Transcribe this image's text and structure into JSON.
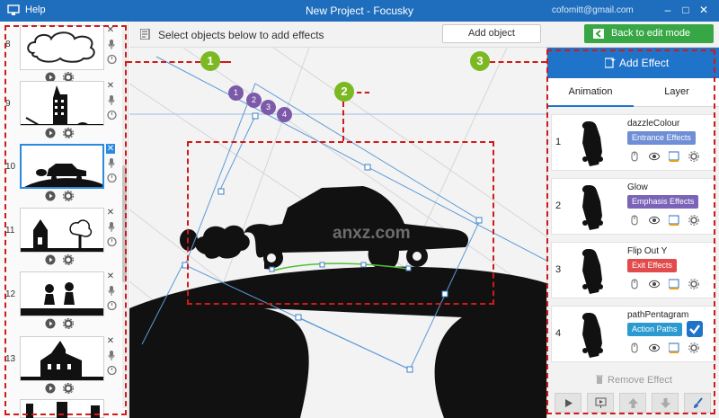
{
  "titlebar": {
    "help": "Help",
    "title": "New Project - Focusky",
    "user": "cofomitt@gmail.com"
  },
  "slides": [
    {
      "num": "8",
      "thumb": "cloud"
    },
    {
      "num": "9",
      "thumb": "building"
    },
    {
      "num": "10",
      "thumb": "car",
      "selected": true
    },
    {
      "num": "11",
      "thumb": "house"
    },
    {
      "num": "12",
      "thumb": "people"
    },
    {
      "num": "13",
      "thumb": "church"
    }
  ],
  "toolbar": {
    "hint": "Select objects below to add effects",
    "add_object": "Add object",
    "back_to_edit": "Back to edit mode"
  },
  "canvas": {
    "order_badges": [
      "1",
      "2",
      "3",
      "4"
    ],
    "watermark": "anxz.com"
  },
  "right_panel": {
    "add_effect": "Add Effect",
    "tabs": [
      "Animation",
      "Layer"
    ],
    "effects": [
      {
        "index": "1",
        "name": "dazzleColour",
        "tag": "Entrance Effects",
        "tag_color": "#6e8ed6"
      },
      {
        "index": "2",
        "name": "Glow",
        "tag": "Emphasis Effects",
        "tag_color": "#7b63b8"
      },
      {
        "index": "3",
        "name": "Flip Out Y",
        "tag": "Exit Effects",
        "tag_color": "#e14b4b"
      },
      {
        "index": "4",
        "name": "pathPentagram",
        "tag": "Action Paths",
        "tag_color": "#2b9ad0",
        "checked": true
      }
    ],
    "remove_effect": "Remove Effect"
  },
  "callouts": [
    "1",
    "2",
    "3"
  ],
  "colors": {
    "title_bar": "#1f6ebd",
    "accent_blue": "#1f73c9",
    "green_button": "#36a744",
    "callout_green": "#7bb821",
    "annotation_red": "#d01a1a"
  }
}
